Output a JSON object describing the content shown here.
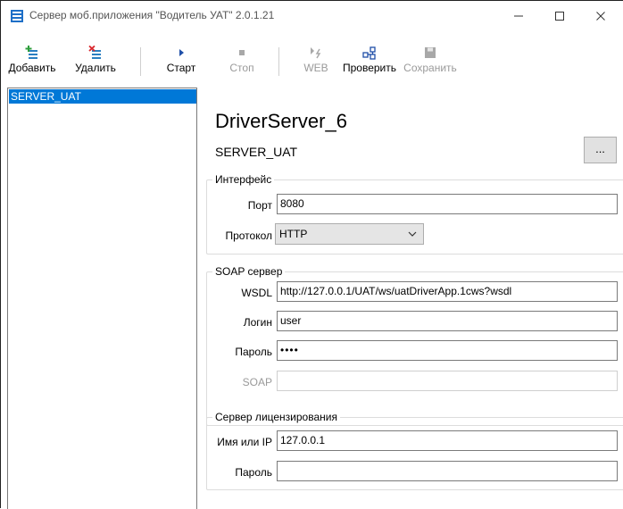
{
  "window": {
    "title": "Сервер моб.приложения \"Водитель УАТ\" 2.0.1.21",
    "minimize_glyph": "—",
    "maximize_glyph": "☐",
    "close_glyph": "✕"
  },
  "toolbar": {
    "add_label": "Добавить",
    "delete_label": "Удалить",
    "start_label": "Старт",
    "stop_label": "Стоп",
    "web_label": "WEB",
    "check_label": "Проверить",
    "save_label": "Сохранить"
  },
  "server_list": {
    "items": [
      {
        "label": "SERVER_UAT",
        "selected": true
      }
    ]
  },
  "detail": {
    "title": "DriverServer_6",
    "subtitle": "SERVER_UAT",
    "browse_label": "..."
  },
  "interface_group": {
    "title": "Интерфейс",
    "port_label": "Порт",
    "port_value": "8080",
    "protocol_label": "Протокол",
    "protocol_value": "HTTP"
  },
  "soap_group": {
    "title": "SOAP сервер",
    "wsdl_label": "WSDL",
    "wsdl_value": "http://127.0.0.1/UAT/ws/uatDriverApp.1cws?wsdl",
    "login_label": "Логин",
    "login_value": "user",
    "password_label": "Пароль",
    "password_value": "••••",
    "soap_label": "SOAP",
    "soap_value": ""
  },
  "license_group": {
    "title": "Сервер лицензирования",
    "host_label": "Имя или IP",
    "host_value": "127.0.0.1",
    "password_label": "Пароль",
    "password_value": ""
  },
  "colors": {
    "selection": "#0078d7",
    "disabled_text": "#9a9a9a",
    "add_icon": "#2e9e3c",
    "delete_icon": "#d9242a",
    "start_icon": "#1f4fa8"
  }
}
